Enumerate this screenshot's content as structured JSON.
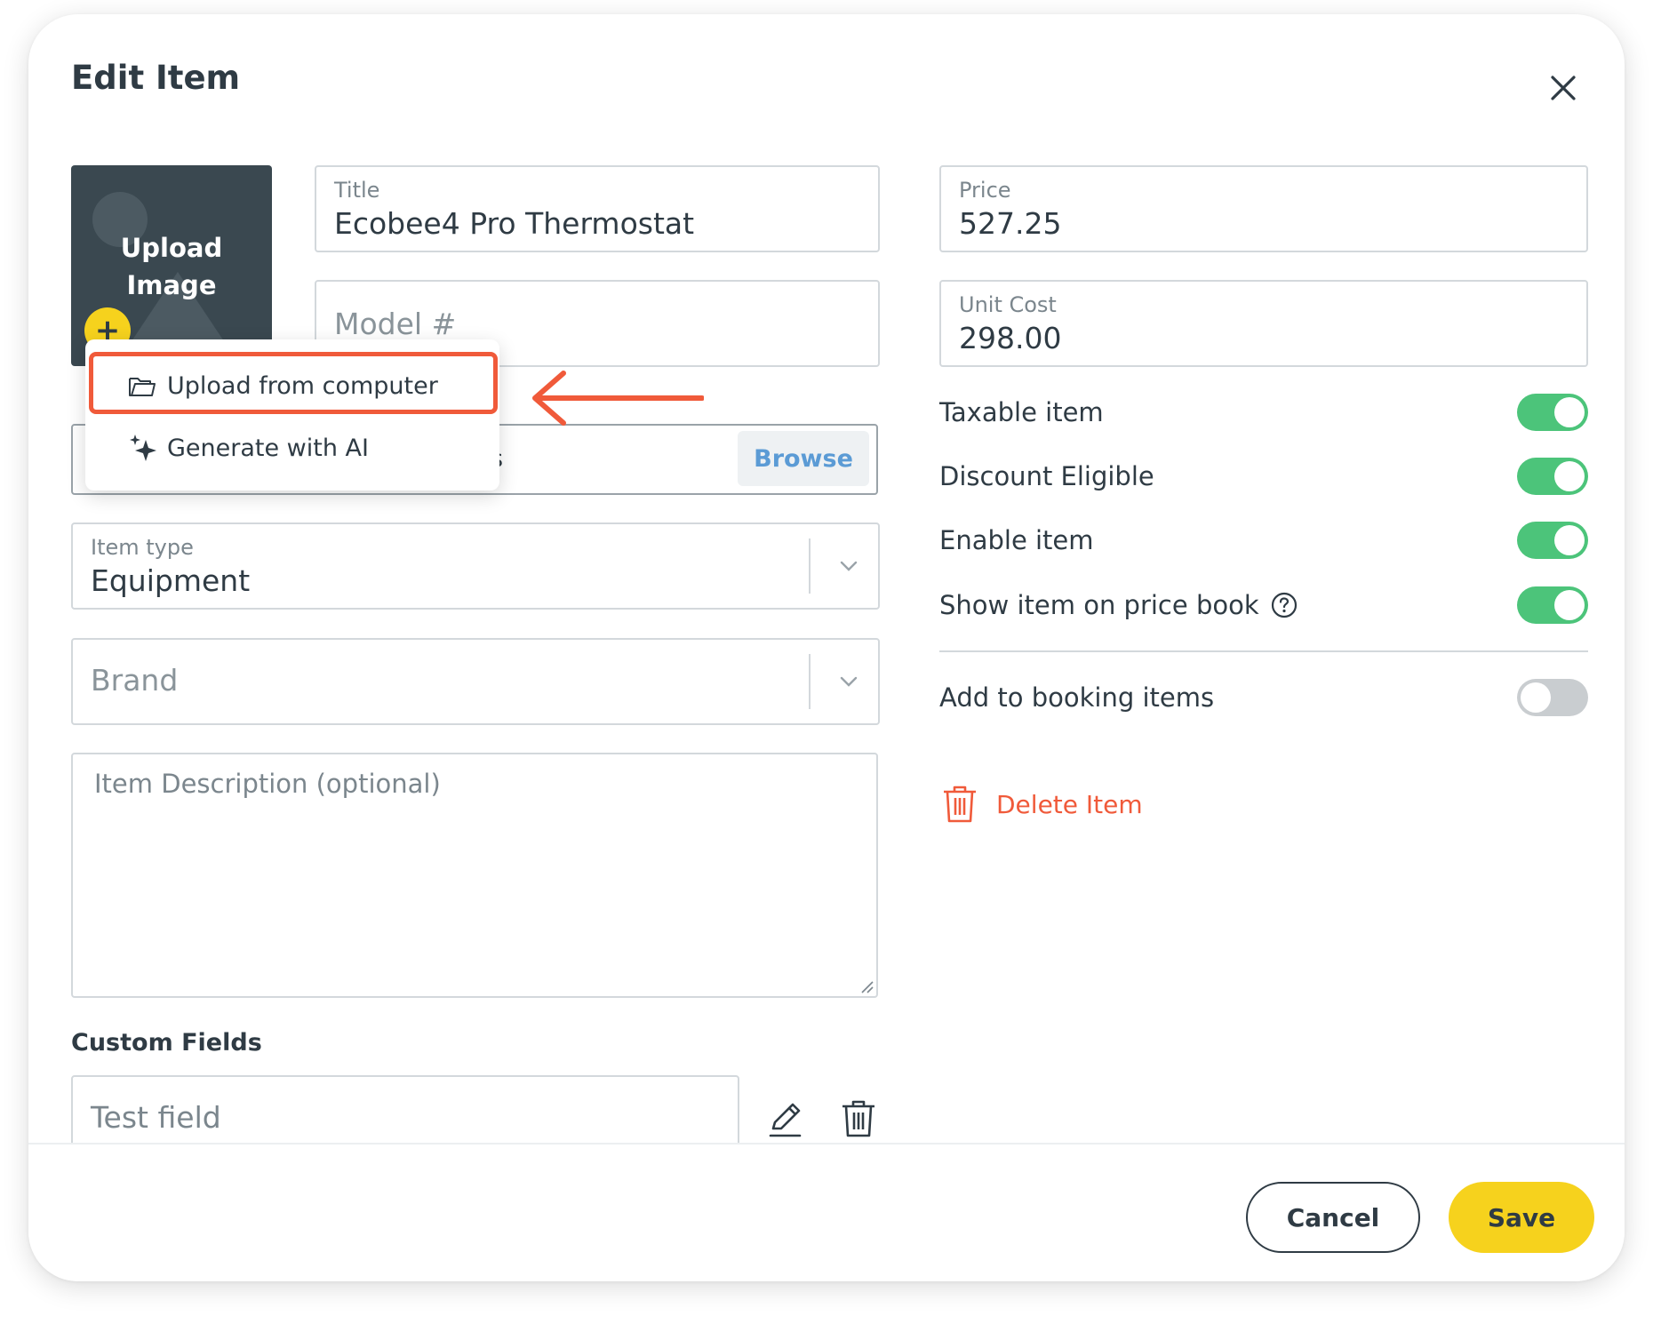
{
  "modal": {
    "title": "Edit Item"
  },
  "uploader": {
    "label_line1": "Upload",
    "label_line2": "Image",
    "plus": "+"
  },
  "menu": {
    "upload_from_computer": "Upload from computer",
    "generate_with_ai": "Generate with AI"
  },
  "fields": {
    "title": {
      "label": "Title",
      "value": "Ecobee4 Pro Thermostat"
    },
    "model": {
      "placeholder": "Model #"
    },
    "attachment": {
      "partial_text": "s",
      "browse": "Browse"
    },
    "item_type": {
      "label": "Item type",
      "value": "Equipment"
    },
    "brand": {
      "placeholder": "Brand"
    },
    "description": {
      "placeholder": "Item Description (optional)"
    },
    "price": {
      "label": "Price",
      "value": "527.25"
    },
    "unit_cost": {
      "label": "Unit Cost",
      "value": "298.00"
    }
  },
  "toggles": [
    {
      "label": "Taxable item",
      "on": true
    },
    {
      "label": "Discount Eligible",
      "on": true
    },
    {
      "label": "Enable item",
      "on": true
    },
    {
      "label": "Show item on price book",
      "on": true,
      "help": true
    },
    {
      "label": "Add to booking items",
      "on": false
    }
  ],
  "delete_item": "Delete Item",
  "custom_fields": {
    "title": "Custom Fields",
    "items": [
      {
        "name": "Test field"
      }
    ]
  },
  "footer": {
    "cancel": "Cancel",
    "save": "Save"
  },
  "colors": {
    "accent_yellow": "#f6d21d",
    "toggle_on": "#4cc47a",
    "toggle_off": "#c9cdd0",
    "danger": "#f05a3a",
    "link_blue": "#5b9bd5"
  }
}
